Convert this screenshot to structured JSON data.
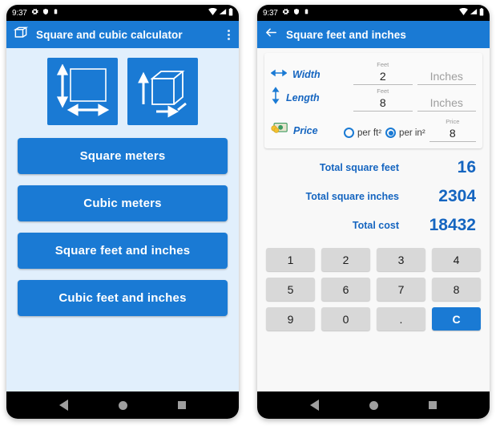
{
  "status_bar": {
    "time": "9:37",
    "left_icons": [
      "gear-icon",
      "shield-icon",
      "clipboard-icon"
    ],
    "right_icons": [
      "wifi-icon",
      "signal-icon",
      "battery-icon"
    ]
  },
  "colors": {
    "primary_blue": "#1a7ad4",
    "label_blue": "#1565c0",
    "page_bg": "#e1effc",
    "card_bg": "#fafafa",
    "key_bg": "#d8d8d8"
  },
  "left_screen": {
    "app_title": "Square and cubic calculator",
    "logo_icon": "cube-icon",
    "overflow_icon": "overflow-menu-icon",
    "hero_icons": [
      {
        "name": "square-dimensions-icon",
        "alt": "square with width and height arrows"
      },
      {
        "name": "cube-dimensions-icon",
        "alt": "cube with three dimension arrows"
      }
    ],
    "buttons": [
      {
        "label": "Square meters",
        "name": "square-meters-button"
      },
      {
        "label": "Cubic meters",
        "name": "cubic-meters-button"
      },
      {
        "label": "Square feet and inches",
        "name": "square-feet-inches-button"
      },
      {
        "label": "Cubic feet and inches",
        "name": "cubic-feet-inches-button"
      }
    ]
  },
  "right_screen": {
    "app_title": "Square feet and inches",
    "back_icon": "back-arrow-icon",
    "inputs": [
      {
        "label": "Width",
        "icon": "horizontal-arrow-icon",
        "feet_caption": "Feet",
        "feet_value": "2",
        "inches_caption": "",
        "inches_placeholder": "Inches",
        "inches_value": ""
      },
      {
        "label": "Length",
        "icon": "vertical-arrow-icon",
        "feet_caption": "Feet",
        "feet_value": "8",
        "inches_caption": "",
        "inches_placeholder": "Inches",
        "inches_value": ""
      }
    ],
    "price": {
      "label": "Price",
      "icon": "money-icon",
      "options": [
        {
          "label": "per ft²",
          "selected": false
        },
        {
          "label": "per in²",
          "selected": true
        }
      ],
      "caption": "Price",
      "value": "8"
    },
    "results": [
      {
        "label": "Total square feet",
        "value": "16"
      },
      {
        "label": "Total square inches",
        "value": "2304"
      },
      {
        "label": "Total cost",
        "value": "18432"
      }
    ],
    "keypad": [
      [
        "1",
        "2",
        "3",
        "4"
      ],
      [
        "5",
        "6",
        "7",
        "8"
      ],
      [
        "9",
        "0",
        ".",
        "C"
      ]
    ],
    "keypad_accent_key": "C"
  },
  "nav_bar": {
    "back": "back-triangle-icon",
    "home": "home-circle-icon",
    "recents": "recents-square-icon"
  }
}
